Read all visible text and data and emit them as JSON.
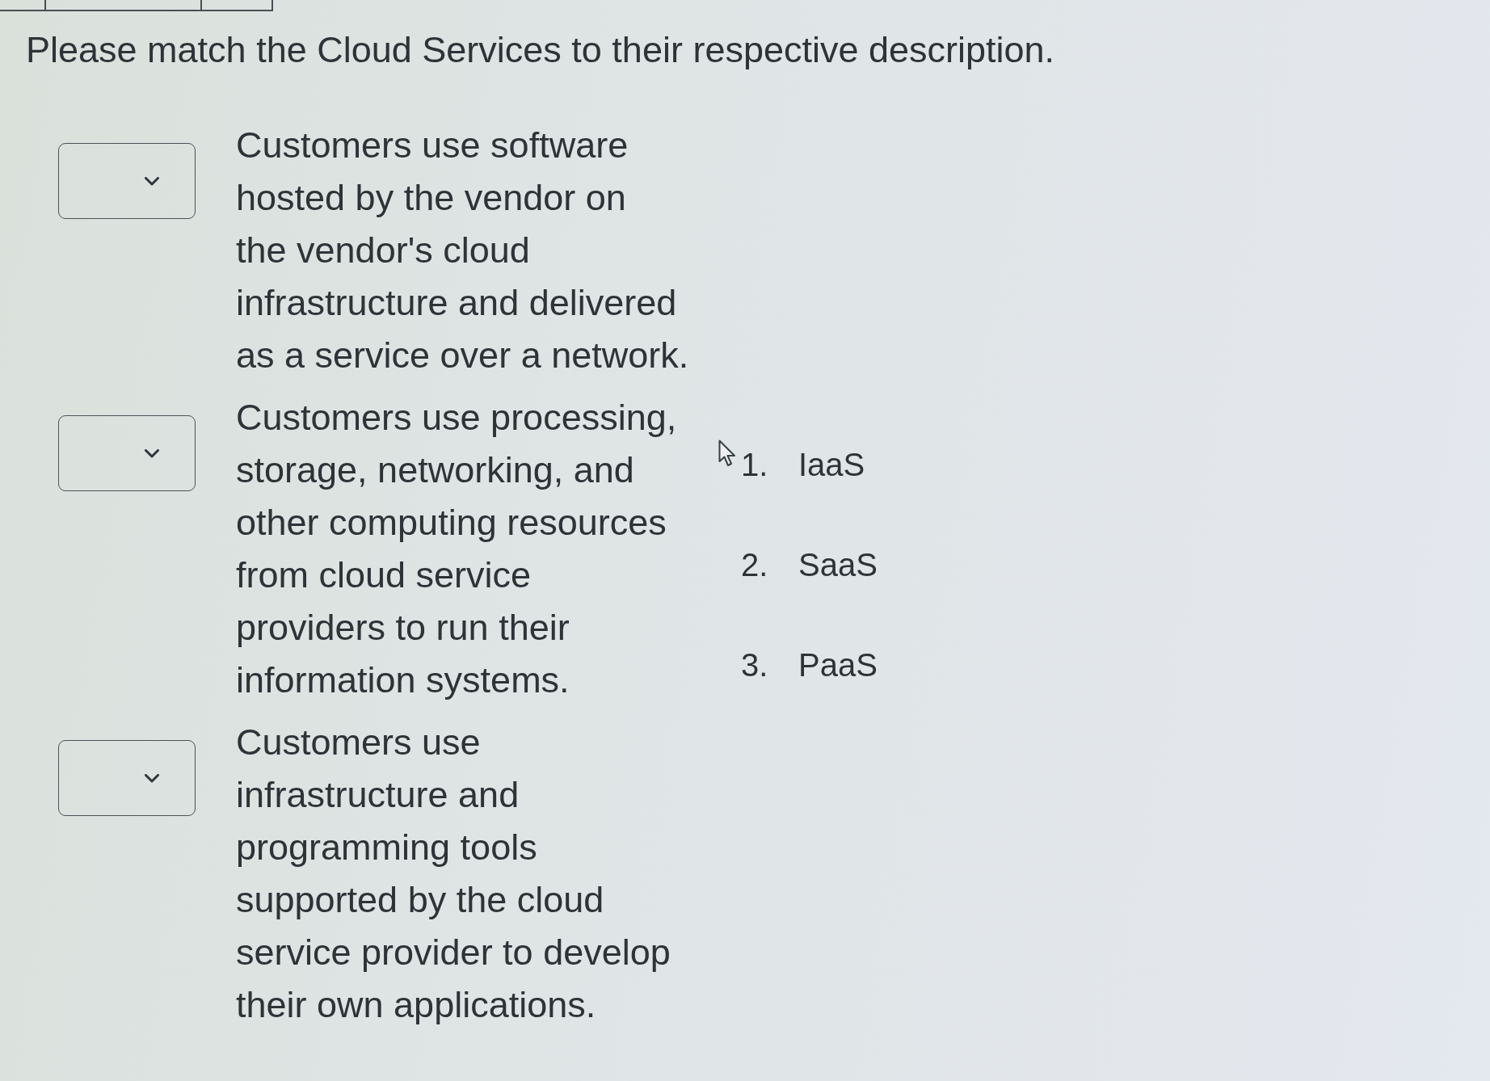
{
  "title": "Please match the Cloud Services to their respective description.",
  "prompts": [
    {
      "text": "Customers use software\nhosted by the vendor on\nthe vendor's cloud\ninfrastructure and delivered\nas a service over a network."
    },
    {
      "text": "Customers use processing,\nstorage, networking, and\nother computing resources\nfrom cloud service\nproviders to run their\ninformation systems."
    },
    {
      "text": "Customers use\ninfrastructure and\nprogramming tools\nsupported by the cloud\nservice provider to develop\ntheir own applications."
    }
  ],
  "options": [
    {
      "number": "1.",
      "label": "IaaS"
    },
    {
      "number": "2.",
      "label": "SaaS"
    },
    {
      "number": "3.",
      "label": "PaaS"
    }
  ]
}
